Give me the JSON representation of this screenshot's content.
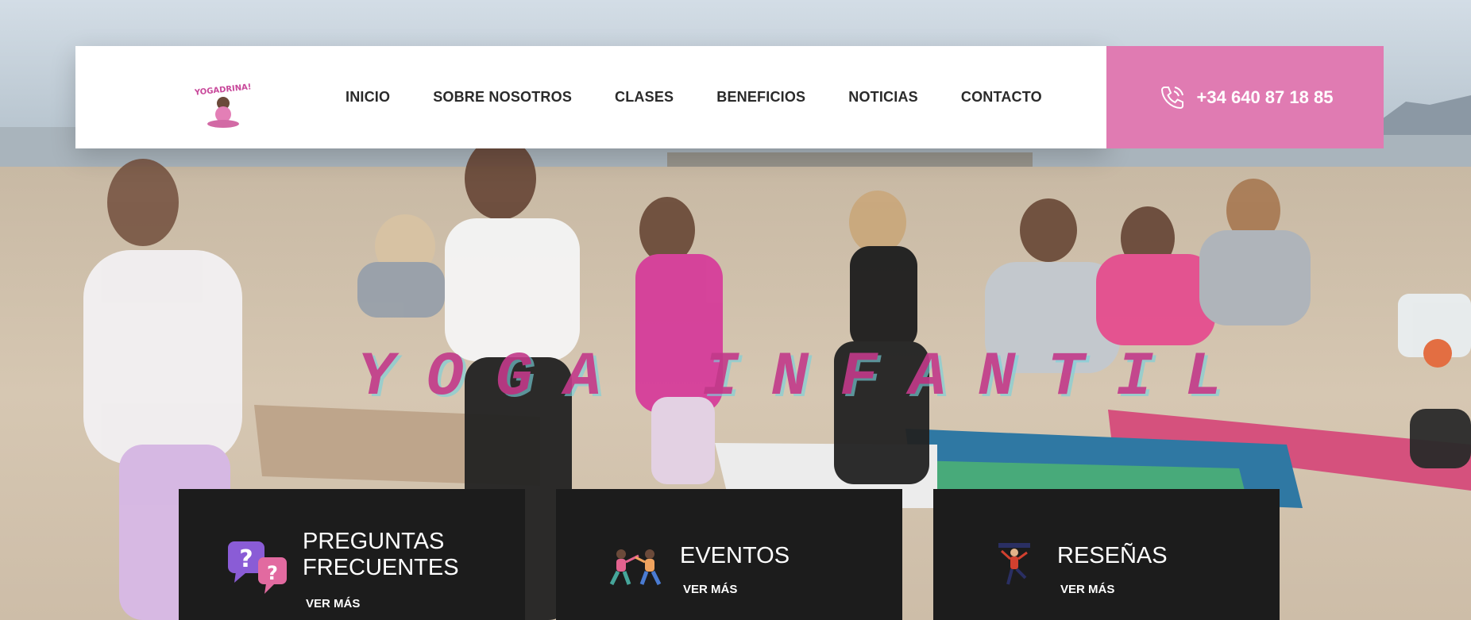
{
  "header": {
    "logo_text": "YOGADRINA!",
    "nav": [
      "INICIO",
      "SOBRE NOSOTROS",
      "CLASES",
      "BENEFICIOS",
      "NOTICIAS",
      "CONTACTO"
    ],
    "phone": "+34 640 87 18 85",
    "phone_bg": "#e07bb2"
  },
  "hero": {
    "title": "YOGA INFANTIL"
  },
  "cards": [
    {
      "title": "PREGUNTAS FRECUENTES",
      "link": "VER MÁS",
      "icon": "faq-speech-bubbles-icon"
    },
    {
      "title": "EVENTOS",
      "link": "VER MÁS",
      "icon": "kids-exercising-icon"
    },
    {
      "title": "RESEÑAS",
      "link": "VER MÁS",
      "icon": "person-jumping-icon"
    }
  ],
  "colors": {
    "accent": "#e07bb2",
    "card_bg": "#1c1c1c",
    "title_color": "#c23a8a"
  }
}
